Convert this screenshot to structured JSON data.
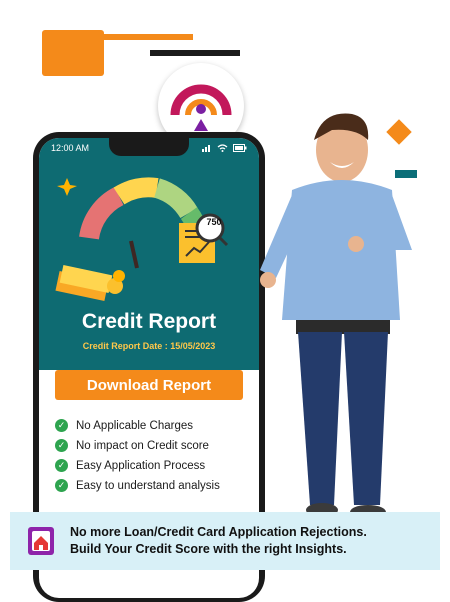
{
  "status_bar": {
    "time": "12:00 AM"
  },
  "hero": {
    "score": "750"
  },
  "title": "Credit Report",
  "report_date": "Credit Report Date : 15/05/2023",
  "download_button": "Download Report",
  "features": [
    "No Applicable Charges",
    "No impact on Credit score",
    "Easy Application Process",
    "Easy to understand analysis"
  ],
  "banner": {
    "line1": "No more Loan/Credit Card Application Rejections.",
    "line2": "Build Your Credit Score with the right Insights."
  },
  "colors": {
    "teal": "#0e6b72",
    "orange": "#f48a1a",
    "check_green": "#2ea44f",
    "banner_bg": "#d8f0f7"
  }
}
